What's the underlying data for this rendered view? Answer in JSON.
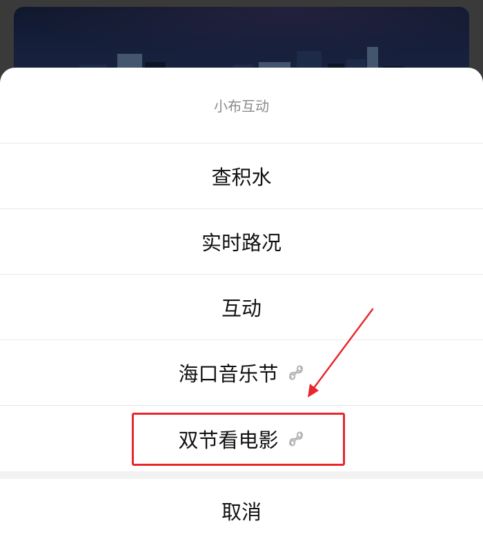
{
  "sheet": {
    "title": "小布互动",
    "options": [
      {
        "label": "查积水",
        "icon": null
      },
      {
        "label": "实时路况",
        "icon": null
      },
      {
        "label": "互动",
        "icon": null
      },
      {
        "label": "海口音乐节",
        "icon": "mini-program-link-icon"
      },
      {
        "label": "双节看电影",
        "icon": "mini-program-link-icon"
      }
    ],
    "cancel_label": "取消"
  },
  "annotation": {
    "highlighted_option": "双节看电影",
    "color": "#e8262b"
  },
  "colors": {
    "sheet_background": "#ffffff",
    "title_text": "#8a8a8a",
    "option_text": "#111111",
    "divider": "#e8e8e8",
    "overlay": "rgba(0,0,0,0.52)"
  }
}
